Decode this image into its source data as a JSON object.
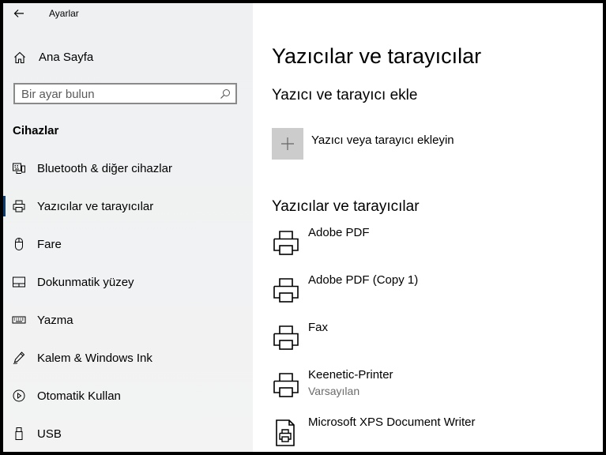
{
  "window": {
    "app_title": "Ayarlar"
  },
  "sidebar": {
    "home_label": "Ana Sayfa",
    "search_placeholder": "Bir ayar bulun",
    "section_heading": "Cihazlar",
    "items": [
      {
        "label": "Bluetooth & diğer cihazlar",
        "icon": "bluetooth-devices-icon",
        "selected": false
      },
      {
        "label": "Yazıcılar ve tarayıcılar",
        "icon": "printer-icon",
        "selected": true
      },
      {
        "label": "Fare",
        "icon": "mouse-icon",
        "selected": false
      },
      {
        "label": "Dokunmatik yüzey",
        "icon": "touchpad-icon",
        "selected": false
      },
      {
        "label": "Yazma",
        "icon": "keyboard-icon",
        "selected": false
      },
      {
        "label": "Kalem & Windows Ink",
        "icon": "pen-icon",
        "selected": false
      },
      {
        "label": "Otomatik Kullan",
        "icon": "autoplay-icon",
        "selected": false
      },
      {
        "label": "USB",
        "icon": "usb-icon",
        "selected": false
      }
    ]
  },
  "main": {
    "page_title": "Yazıcılar ve tarayıcılar",
    "add_heading": "Yazıcı ve tarayıcı ekle",
    "add_button_label": "Yazıcı veya tarayıcı ekleyin",
    "list_heading": "Yazıcılar ve tarayıcılar",
    "printers": [
      {
        "name": "Adobe PDF",
        "status": "",
        "icon": "printer-icon"
      },
      {
        "name": "Adobe PDF (Copy 1)",
        "status": "",
        "icon": "printer-icon"
      },
      {
        "name": "Fax",
        "status": "",
        "icon": "printer-icon"
      },
      {
        "name": "Keenetic-Printer",
        "status": "Varsayılan",
        "icon": "printer-icon"
      },
      {
        "name": "Microsoft XPS Document Writer",
        "status": "",
        "icon": "document-printer-icon"
      }
    ]
  },
  "colors": {
    "selection_bar": "#0c3d6e",
    "add_tile": "#cccccc",
    "status_text": "#6b6b6b"
  }
}
